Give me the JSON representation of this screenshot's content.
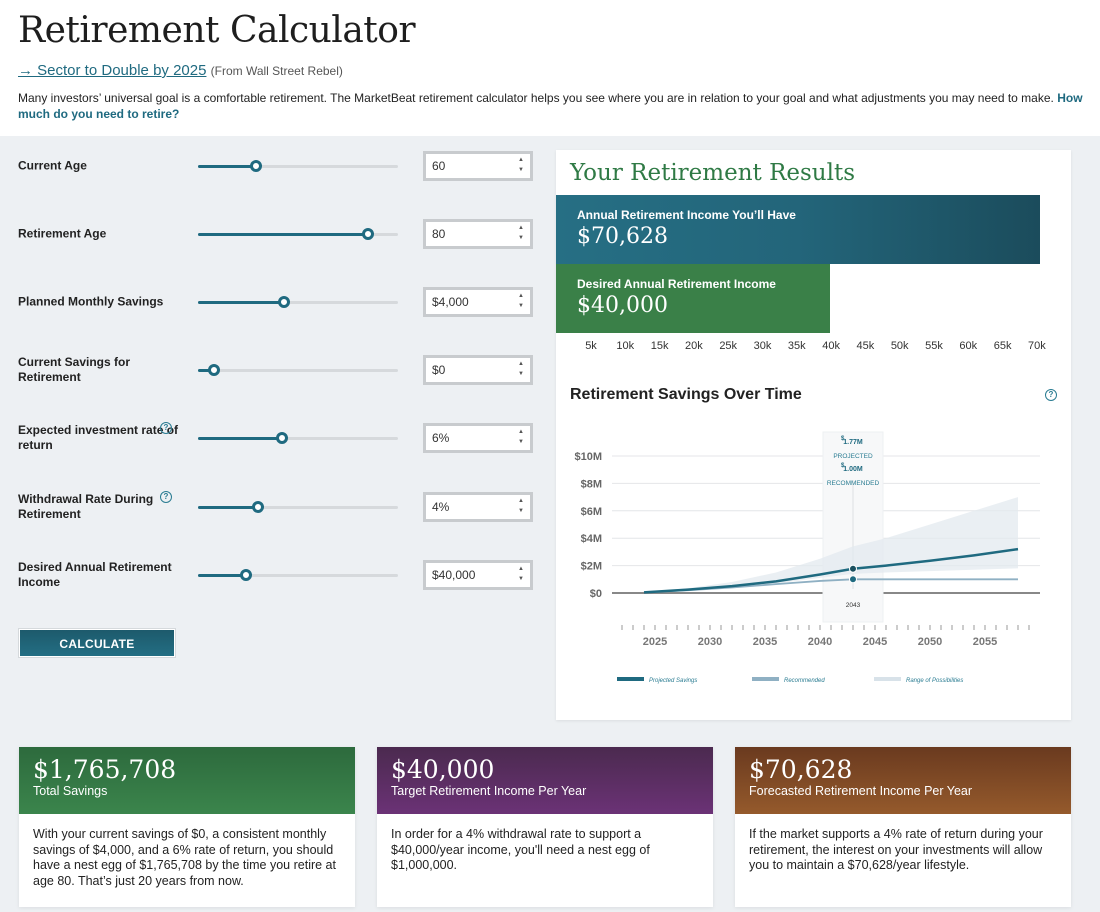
{
  "header": {
    "title": "Retirement Calculator",
    "promo_link": "→ Sector to Double by 2025",
    "promo_source": "(From Wall Street Rebel)",
    "intro_text": "Many investors’ universal goal is a comfortable retirement. The MarketBeat retirement calculator helps you see where you are in relation to your goal and what adjustments you may need to make. ",
    "intro_link": "How much do you need to retire?"
  },
  "form": {
    "fields": [
      {
        "label": "Current Age",
        "value": "60",
        "slider_fraction": 0.29,
        "help": false
      },
      {
        "label": "Retirement Age",
        "value": "80",
        "slider_fraction": 0.85,
        "help": false
      },
      {
        "label": "Planned Monthly Savings",
        "value": "$4,000",
        "slider_fraction": 0.43,
        "help": false
      },
      {
        "label": "Current Savings for Retirement",
        "value": "$0",
        "slider_fraction": 0.08,
        "help": false
      },
      {
        "label": "Expected investment rate of return",
        "value": "6%",
        "slider_fraction": 0.42,
        "help": true
      },
      {
        "label": "Withdrawal Rate During Retirement",
        "value": "4%",
        "slider_fraction": 0.3,
        "help": true
      },
      {
        "label": "Desired Annual Retirement Income",
        "value": "$40,000",
        "slider_fraction": 0.24,
        "help": true
      }
    ],
    "help_glyph": "?",
    "spin_up": "▲",
    "spin_down": "▼",
    "calculate_label": "CALCULATE"
  },
  "results": {
    "title": "Your Retirement Results",
    "have_label": "Annual Retirement Income You’ll Have",
    "have_value": "$70,628",
    "want_label": "Desired Annual Retirement Income",
    "want_value": "$40,000",
    "axis_ticks": [
      "5k",
      "10k",
      "15k",
      "20k",
      "25k",
      "30k",
      "35k",
      "40k",
      "45k",
      "50k",
      "55k",
      "60k",
      "65k",
      "70k"
    ],
    "chart_title": "Retirement Savings Over Time",
    "help_glyph": "?"
  },
  "chart_data": {
    "type": "line",
    "title": "Retirement Savings Over Time",
    "xlabel": "",
    "ylabel": "",
    "x_ticks": [
      "2025",
      "2030",
      "2035",
      "2040",
      "2045",
      "2050",
      "2055"
    ],
    "y_ticks": [
      "$0",
      "$2M",
      "$4M",
      "$6M",
      "$8M",
      "$10M"
    ],
    "ylim": [
      0,
      10
    ],
    "xlim": [
      2021,
      2060
    ],
    "units": "$M",
    "x": [
      2024,
      2028,
      2032,
      2036,
      2040,
      2043,
      2046,
      2050,
      2054,
      2058
    ],
    "series": [
      {
        "name": "Projected Savings",
        "color": "#1f6a80",
        "values": [
          0.05,
          0.25,
          0.5,
          0.85,
          1.35,
          1.77,
          2.0,
          2.35,
          2.75,
          3.2
        ]
      },
      {
        "name": "Recommended",
        "color": "#8fb0c3",
        "values": [
          0.04,
          0.2,
          0.4,
          0.65,
          0.88,
          1.0,
          1.0,
          1.0,
          1.0,
          1.0
        ]
      },
      {
        "name": "Range of Possibilities",
        "color": "#dde6ec",
        "type": "area",
        "low": [
          0.04,
          0.2,
          0.4,
          0.7,
          1.1,
          1.4,
          1.5,
          1.6,
          1.7,
          1.8
        ],
        "high": [
          0.06,
          0.35,
          0.8,
          1.5,
          2.5,
          3.4,
          4.0,
          5.0,
          6.0,
          7.0
        ]
      }
    ],
    "tooltip": {
      "year": "2043",
      "projected": "1.77M",
      "projected_label": "PROJECTED",
      "recommended": "1.00M",
      "recommended_label": "RECOMMENDED",
      "currency": "$"
    },
    "legend": [
      "Projected Savings",
      "Recommended",
      "Range of Possibilities"
    ],
    "legend_position": "bottom",
    "grid": true
  },
  "cards": [
    {
      "value": "$1,765,708",
      "label": "Total Savings",
      "text": "With your current savings of $0, a consistent monthly savings of $4,000, and a 6% rate of return, you should have a nest egg of $1,765,708 by the time you retire at age 80. That’s just 20 years from now.",
      "color": "#3b854c"
    },
    {
      "value": "$40,000",
      "label": "Target Retirement Income Per Year",
      "text": "In order for a 4% withdrawal rate to support a $40,000/year income, you'll need a nest egg of $1,000,000.",
      "color": "#6b3276"
    },
    {
      "value": "$70,628",
      "label": "Forecasted Retirement Income Per Year",
      "text": "If the market supports a 4% rate of return during your retirement, the interest on your investments will allow you to maintain a $70,628/year lifestyle.",
      "color": "#955a2c"
    }
  ]
}
